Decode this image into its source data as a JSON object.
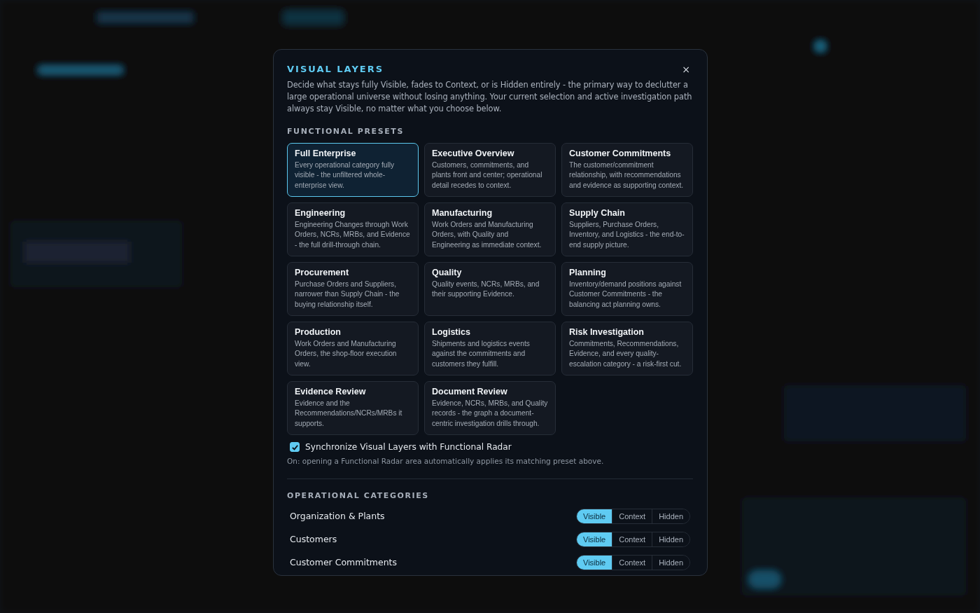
{
  "dialog": {
    "title": "VISUAL LAYERS",
    "close": "×",
    "description": "Decide what stays fully Visible, fades to Context, or is Hidden entirely - the primary way to declutter a large operational universe without losing anything. Your current selection and active investigation path always stay Visible, no matter what you choose below."
  },
  "presets": {
    "heading": "FUNCTIONAL PRESETS",
    "items": [
      {
        "title": "Full Enterprise",
        "description": "Every operational category fully visible - the unfiltered whole-enterprise view.",
        "selected": true
      },
      {
        "title": "Executive Overview",
        "description": "Customers, commitments, and plants front and center; operational detail recedes to context.",
        "selected": false
      },
      {
        "title": "Customer Commitments",
        "description": "The customer/commitment relationship, with recommendations and evidence as supporting context.",
        "selected": false
      },
      {
        "title": "Engineering",
        "description": "Engineering Changes through Work Orders, NCRs, MRBs, and Evidence - the full drill-through chain.",
        "selected": false
      },
      {
        "title": "Manufacturing",
        "description": "Work Orders and Manufacturing Orders, with Quality and Engineering as immediate context.",
        "selected": false
      },
      {
        "title": "Supply Chain",
        "description": "Suppliers, Purchase Orders, Inventory, and Logistics - the end-to-end supply picture.",
        "selected": false
      },
      {
        "title": "Procurement",
        "description": "Purchase Orders and Suppliers, narrower than Supply Chain - the buying relationship itself.",
        "selected": false
      },
      {
        "title": "Quality",
        "description": "Quality events, NCRs, MRBs, and their supporting Evidence.",
        "selected": false
      },
      {
        "title": "Planning",
        "description": "Inventory/demand positions against Customer Commitments - the balancing act planning owns.",
        "selected": false
      },
      {
        "title": "Production",
        "description": "Work Orders and Manufacturing Orders, the shop-floor execution view.",
        "selected": false
      },
      {
        "title": "Logistics",
        "description": "Shipments and logistics events against the commitments and customers they fulfill.",
        "selected": false
      },
      {
        "title": "Risk Investigation",
        "description": "Commitments, Recommendations, Evidence, and every quality-escalation category - a risk-first cut.",
        "selected": false
      },
      {
        "title": "Evidence Review",
        "description": "Evidence and the Recommendations/NCRs/MRBs it supports.",
        "selected": false
      },
      {
        "title": "Document Review",
        "description": "Evidence, NCRs, MRBs, and Quality records - the graph a document-centric investigation drills through.",
        "selected": false
      }
    ]
  },
  "sync": {
    "label": "Synchronize Visual Layers with Functional Radar",
    "checked": true,
    "note": "On: opening a Functional Radar area automatically applies its matching preset above."
  },
  "categories": {
    "heading": "OPERATIONAL CATEGORIES",
    "items": [
      {
        "name": "Organization & Plants",
        "options": [
          {
            "label": "Visible",
            "selected": true
          },
          {
            "label": "Context",
            "selected": false
          },
          {
            "label": "Hidden",
            "selected": false
          }
        ]
      },
      {
        "name": "Customers",
        "options": [
          {
            "label": "Visible",
            "selected": true
          },
          {
            "label": "Context",
            "selected": false
          },
          {
            "label": "Hidden",
            "selected": false
          }
        ]
      },
      {
        "name": "Customer Commitments",
        "options": [
          {
            "label": "Visible",
            "selected": true
          },
          {
            "label": "Context",
            "selected": false
          },
          {
            "label": "Hidden",
            "selected": false
          }
        ]
      }
    ]
  }
}
